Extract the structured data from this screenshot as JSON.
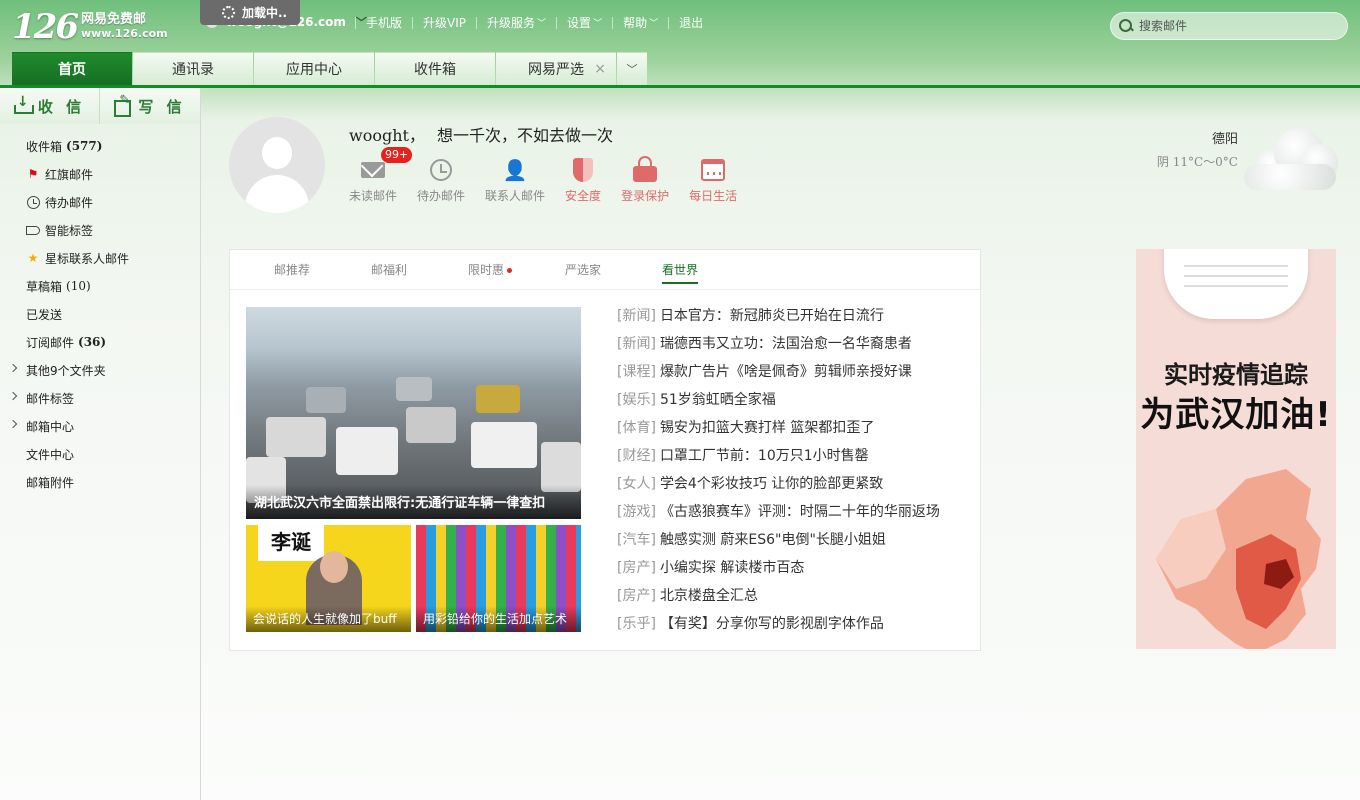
{
  "logo": {
    "number": "126",
    "line1": "网易免费邮",
    "line2": "www.126.com"
  },
  "loading": "加载中..",
  "account": "wooght@126.com",
  "topnav": [
    {
      "label": "手机版",
      "dropdown": false
    },
    {
      "label": "升级VIP",
      "dropdown": false
    },
    {
      "label": "升级服务",
      "dropdown": true
    },
    {
      "label": "设置",
      "dropdown": true
    },
    {
      "label": "帮助",
      "dropdown": true
    },
    {
      "label": "退出",
      "dropdown": false
    }
  ],
  "search": {
    "placeholder": "搜索邮件"
  },
  "tabs": [
    {
      "label": "首页",
      "active": true
    },
    {
      "label": "通讯录"
    },
    {
      "label": "应用中心"
    },
    {
      "label": "收件箱"
    },
    {
      "label": "网易严选",
      "closable": true
    }
  ],
  "sidebar": {
    "receive": "收 信",
    "compose": "写 信",
    "folders": [
      {
        "label": "收件箱",
        "count": "(577)",
        "bold": true
      },
      {
        "label": "红旗邮件",
        "icon": "flag-icon"
      },
      {
        "label": "待办邮件",
        "icon": "clock-icon"
      },
      {
        "label": "智能标签",
        "icon": "tag-icon"
      },
      {
        "label": "星标联系人邮件",
        "icon": "star-icon"
      },
      {
        "label": "草稿箱",
        "count": "(10)"
      },
      {
        "label": "已发送"
      },
      {
        "label": "订阅邮件",
        "count": "(36)",
        "bold": true
      },
      {
        "label": "其他9个文件夹",
        "expandable": true
      },
      {
        "label": "邮件标签",
        "expandable": true
      },
      {
        "label": "邮箱中心",
        "expandable": true
      },
      {
        "label": "文件中心"
      },
      {
        "label": "邮箱附件"
      }
    ]
  },
  "profile": {
    "username": "wooght，",
    "motto": "想一千次，不如去做一次",
    "quick": [
      {
        "label": "未读邮件",
        "badge": "99+",
        "icon": "envelope-icon"
      },
      {
        "label": "待办邮件",
        "icon": "clock-icon"
      },
      {
        "label": "联系人邮件",
        "icon": "contact-star-icon"
      },
      {
        "label": "安全度",
        "icon": "shield-icon",
        "red": true
      },
      {
        "label": "登录保护",
        "icon": "lock-icon",
        "red": true
      },
      {
        "label": "每日生活",
        "icon": "calendar-icon",
        "red": true
      }
    ]
  },
  "weather": {
    "city": "德阳",
    "condition": "阴 11°C～0°C"
  },
  "news_tabs": [
    {
      "label": "邮推荐"
    },
    {
      "label": "邮福利"
    },
    {
      "label": "限时惠",
      "dot": true
    },
    {
      "label": "严选家"
    },
    {
      "label": "看世界",
      "active": true
    }
  ],
  "featured": {
    "main_caption": "湖北武汉六市全面禁出限行:无通行证车辆一律查扣",
    "thumb1_caption": "会说话的人生就像加了buff",
    "thumb1_label": "李诞",
    "thumb2_caption": "用彩铅给你的生活加点艺术"
  },
  "news": [
    {
      "cat": "[新闻]",
      "title": "日本官方：新冠肺炎已开始在日流行"
    },
    {
      "cat": "[新闻]",
      "title": "瑞德西韦又立功：法国治愈一名华裔患者"
    },
    {
      "cat": "[课程]",
      "title": "爆款广告片《啥是佩奇》剪辑师亲授好课"
    },
    {
      "cat": "[娱乐]",
      "title": "51岁翁虹晒全家福"
    },
    {
      "cat": "[体育]",
      "title": "锡安为扣篮大赛打样 篮架都扣歪了"
    },
    {
      "cat": "[财经]",
      "title": "口罩工厂节前：10万只1小时售罄"
    },
    {
      "cat": "[女人]",
      "title": "学会4个彩妆技巧 让你的脸部更紧致"
    },
    {
      "cat": "[游戏]",
      "title": "《古惑狼赛车》评测：时隔二十年的华丽返场"
    },
    {
      "cat": "[汽车]",
      "title": "触感实测 蔚来ES6\"电倒\"长腿小姐姐"
    },
    {
      "cat": "[房产]",
      "title": "小编实探 解读楼市百态"
    },
    {
      "cat": "[房产]",
      "title": "北京楼盘全汇总"
    },
    {
      "cat": "[乐乎]",
      "title": "【有奖】分享你写的影视剧字体作品"
    }
  ],
  "ad": {
    "line1": "实时疫情追踪",
    "line2": "为武汉加油!"
  }
}
